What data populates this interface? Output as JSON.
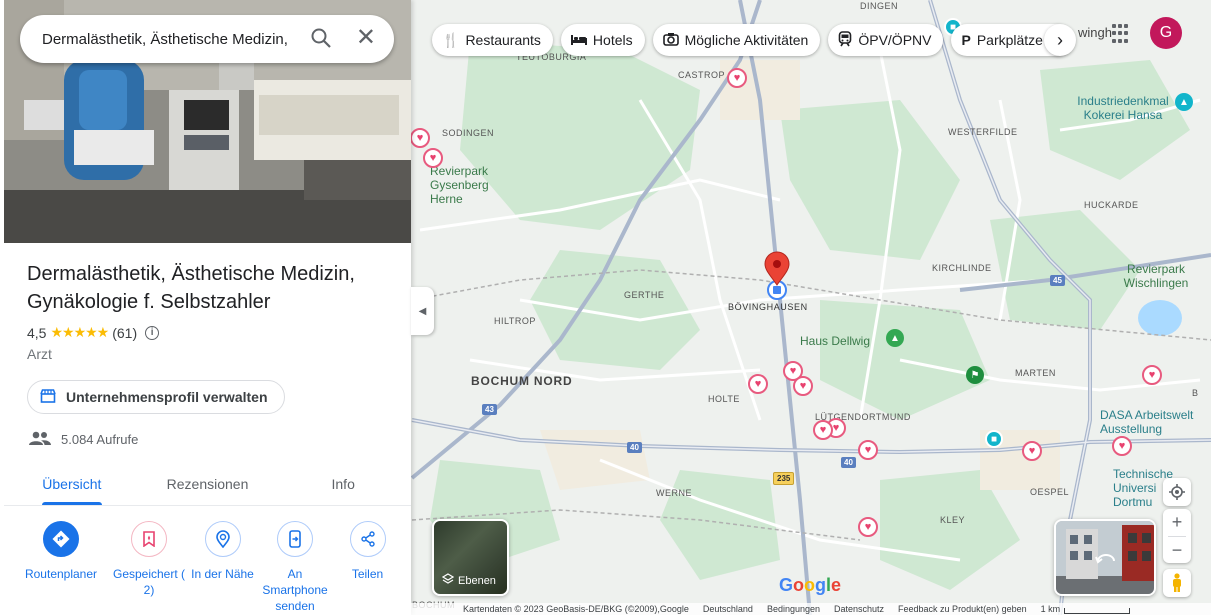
{
  "search": {
    "query": "Dermalästhetik, Ästhetische Medizin,"
  },
  "place": {
    "name": "Dermalästhetik, Ästhetische Medizin, Gynäkologie f. Selbstzahler",
    "rating": "4,5",
    "stars": "★★★★★",
    "review_count": "(61)",
    "category": "Arzt",
    "manage_label": "Unternehmensprofil verwalten",
    "views": "5.084 Aufrufe"
  },
  "tabs": [
    "Übersicht",
    "Rezensionen",
    "Info"
  ],
  "actions": [
    "Routenplaner",
    "Gespeichert ( 2)",
    "In der Nähe",
    "An Smartphone senden",
    "Teilen"
  ],
  "chips": [
    "Restaurants",
    "Hotels",
    "Mögliche Aktivitäten",
    "ÖPV/ÖPNV",
    "Parkplätze"
  ],
  "avatar": "G",
  "map_labels": {
    "dingen": "DINGEN",
    "teutoburgia": "TEUTOBURGIA",
    "castrop": "CASTROP",
    "sodingen": "SODINGEN",
    "westerfilde": "WESTERFILDE",
    "huckarde": "HUCKARDE",
    "gerthe": "GERTHE",
    "boevinghausen": "BÖVINGHAUSEN",
    "kirchlinde": "KIRCHLINDE",
    "hiltrop": "HILTROP",
    "bochum_nord": "BOCHUM NORD",
    "holte": "HOLTE",
    "luetgendortmund": "LÜTGENDORTMUND",
    "marten": "MARTEN",
    "werne": "WERNE",
    "oespel": "OESPEL",
    "kley": "KLEY",
    "bochum_bottom": "BOCHUM",
    "revierpark_gysenberg": "Revierpark Gysenberg Herne",
    "haus_dellwig": "Haus Dellwig",
    "industriedenkmal": "Industriedenkmal Kokerei Hansa",
    "revierpark_wischlingen": "Revierpark Wischlingen",
    "dasa": "DASA Arbeitswelt Ausstellung",
    "tu_dortmund": "Technische Universi Dortmu",
    "twinghe": "wingh",
    "b": "B"
  },
  "road_shields": {
    "a43": "43",
    "a40a": "40",
    "a40b": "40",
    "a45": "45",
    "b235": "235"
  },
  "layers_label": "Ebenen",
  "google_logo": "Google",
  "footer": {
    "copyright": "Kartendaten © 2023 GeoBasis-DE/BKG (©2009),Google",
    "country": "Deutschland",
    "terms": "Bedingungen",
    "privacy": "Datenschutz",
    "feedback": "Feedback zu Produkt(en) geben",
    "scale": "1 km"
  },
  "colors": {
    "accent": "#1a73e8",
    "pin": "#ea4335",
    "heart": "#e8426f",
    "avatar": "#c2185b",
    "star": "#fbbc04"
  },
  "icons": {
    "restaurants": "fork-knife-icon",
    "hotels": "bed-icon",
    "activities": "camera-icon",
    "transit": "train-icon",
    "parking": "parking-icon"
  }
}
